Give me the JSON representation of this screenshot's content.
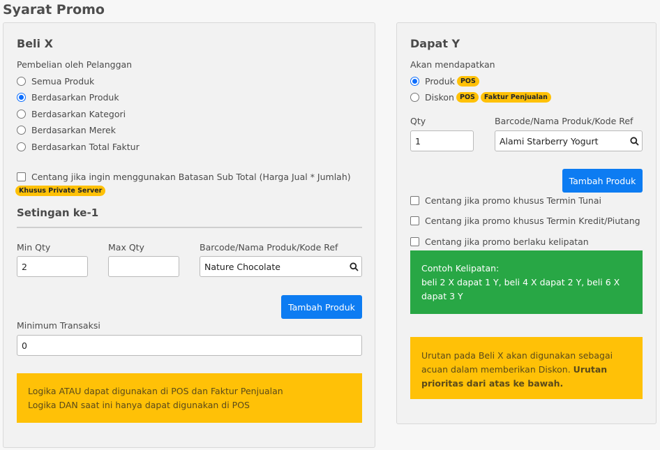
{
  "page": {
    "title": "Syarat Promo"
  },
  "beli_x": {
    "heading": "Beli X",
    "purchase_label": "Pembelian oleh Pelanggan",
    "options": [
      {
        "label": "Semua Produk",
        "checked": false
      },
      {
        "label": "Berdasarkan Produk",
        "checked": true
      },
      {
        "label": "Berdasarkan Kategori",
        "checked": false
      },
      {
        "label": "Berdasarkan Merek",
        "checked": false
      },
      {
        "label": "Berdasarkan Total Faktur",
        "checked": false
      }
    ],
    "subtotal_check_label": "Centang jika ingin menggunakan Batasan Sub Total (Harga Jual * Jumlah)",
    "private_badge": "Khusus Private Server",
    "setting_title": "Setingan ke-1",
    "min_qty_label": "Min Qty",
    "min_qty_value": "2",
    "max_qty_label": "Max Qty",
    "max_qty_value": "",
    "barcode_label": "Barcode/Nama Produk/Kode Ref",
    "barcode_value": "Nature Chocolate",
    "add_button": "Tambah Produk",
    "min_trans_label": "Minimum Transaksi",
    "min_trans_value": "0",
    "alert_line1": "Logika ATAU dapat digunakan di POS dan Faktur Penjualan",
    "alert_line2": "Logika DAN saat ini hanya dapat digunakan di POS"
  },
  "dapat_y": {
    "heading": "Dapat Y",
    "receive_label": "Akan mendapatkan",
    "opt_produk": "Produk",
    "opt_diskon": "Diskon",
    "badge_pos": "POS",
    "badge_faktur": "Faktur Penjualan",
    "qty_label": "Qty",
    "qty_value": "1",
    "barcode_label": "Barcode/Nama Produk/Kode Ref",
    "barcode_value": "Alami Starberry Yogurt",
    "add_button": "Tambah Produk",
    "check_tunai": "Centang jika promo khusus Termin Tunai",
    "check_kredit": "Centang jika promo khusus Termin Kredit/Piutang",
    "check_kelipatan": "Centang jika promo berlaku kelipatan",
    "green_line1": "Contoh Kelipatan:",
    "green_line2": "beli 2 X dapat 1 Y, beli 4 X dapat 2 Y, beli 6 X dapat 3 Y",
    "yellow_text": "Urutan pada Beli X akan digunakan sebagai acuan dalam memberikan Diskon.",
    "yellow_bold": "Urutan prioritas dari atas ke bawah."
  },
  "colors": {
    "primary": "#0d7cf2",
    "warning": "#ffc107",
    "success": "#28a745"
  },
  "icons": {
    "search": "search-icon"
  }
}
